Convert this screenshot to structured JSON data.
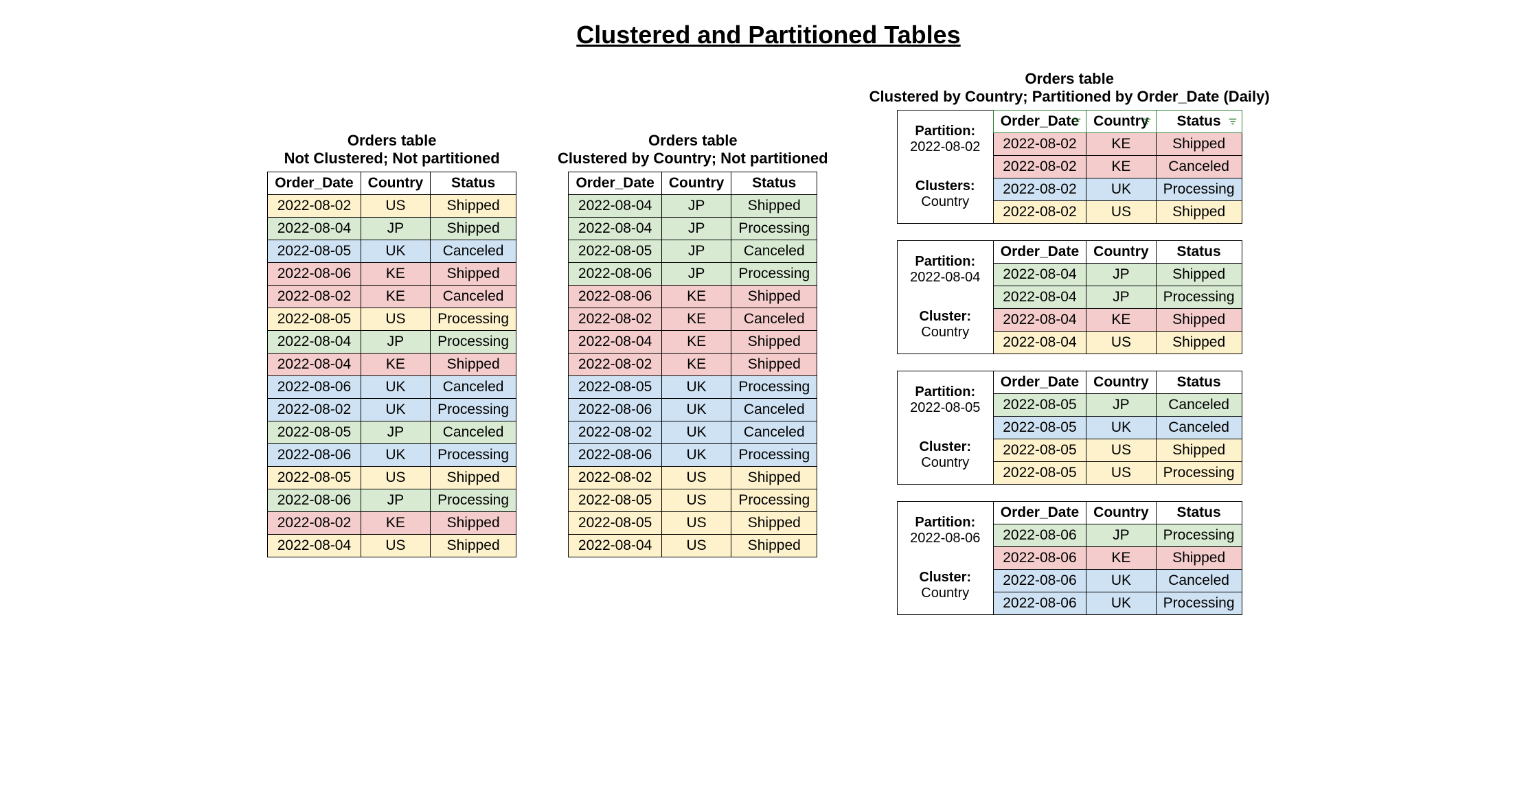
{
  "title": "Clustered and Partitioned Tables",
  "columns": [
    "Order_Date",
    "Country",
    "Status"
  ],
  "colors": {
    "US": "c-us",
    "JP": "c-jp",
    "UK": "c-uk",
    "KE": "c-ke"
  },
  "left": {
    "title": "Orders table",
    "subtitle": "Not Clustered; Not partitioned",
    "rows": [
      [
        "2022-08-02",
        "US",
        "Shipped"
      ],
      [
        "2022-08-04",
        "JP",
        "Shipped"
      ],
      [
        "2022-08-05",
        "UK",
        "Canceled"
      ],
      [
        "2022-08-06",
        "KE",
        "Shipped"
      ],
      [
        "2022-08-02",
        "KE",
        "Canceled"
      ],
      [
        "2022-08-05",
        "US",
        "Processing"
      ],
      [
        "2022-08-04",
        "JP",
        "Processing"
      ],
      [
        "2022-08-04",
        "KE",
        "Shipped"
      ],
      [
        "2022-08-06",
        "UK",
        "Canceled"
      ],
      [
        "2022-08-02",
        "UK",
        "Processing"
      ],
      [
        "2022-08-05",
        "JP",
        "Canceled"
      ],
      [
        "2022-08-06",
        "UK",
        "Processing"
      ],
      [
        "2022-08-05",
        "US",
        "Shipped"
      ],
      [
        "2022-08-06",
        "JP",
        "Processing"
      ],
      [
        "2022-08-02",
        "KE",
        "Shipped"
      ],
      [
        "2022-08-04",
        "US",
        "Shipped"
      ]
    ]
  },
  "mid": {
    "title": "Orders table",
    "subtitle": "Clustered by Country; Not partitioned",
    "rows": [
      [
        "2022-08-04",
        "JP",
        "Shipped"
      ],
      [
        "2022-08-04",
        "JP",
        "Processing"
      ],
      [
        "2022-08-05",
        "JP",
        "Canceled"
      ],
      [
        "2022-08-06",
        "JP",
        "Processing"
      ],
      [
        "2022-08-06",
        "KE",
        "Shipped"
      ],
      [
        "2022-08-02",
        "KE",
        "Canceled"
      ],
      [
        "2022-08-04",
        "KE",
        "Shipped"
      ],
      [
        "2022-08-02",
        "KE",
        "Shipped"
      ],
      [
        "2022-08-05",
        "UK",
        "Processing"
      ],
      [
        "2022-08-06",
        "UK",
        "Canceled"
      ],
      [
        "2022-08-02",
        "UK",
        "Canceled"
      ],
      [
        "2022-08-06",
        "UK",
        "Processing"
      ],
      [
        "2022-08-02",
        "US",
        "Shipped"
      ],
      [
        "2022-08-05",
        "US",
        "Processing"
      ],
      [
        "2022-08-05",
        "US",
        "Shipped"
      ],
      [
        "2022-08-04",
        "US",
        "Shipped"
      ]
    ]
  },
  "right": {
    "title": "Orders table",
    "subtitle": "Clustered by Country; Partitioned by Order_Date (Daily)",
    "showFilterIcons": true,
    "partitions": [
      {
        "partitionLabel": "Partition:",
        "partitionValue": "2022-08-02",
        "clusterLabel": "Clusters:",
        "clusterValue": "Country",
        "highlightHeader": true,
        "rows": [
          [
            "2022-08-02",
            "KE",
            "Shipped"
          ],
          [
            "2022-08-02",
            "KE",
            "Canceled"
          ],
          [
            "2022-08-02",
            "UK",
            "Processing"
          ],
          [
            "2022-08-02",
            "US",
            "Shipped"
          ]
        ]
      },
      {
        "partitionLabel": "Partition:",
        "partitionValue": "2022-08-04",
        "clusterLabel": "Cluster:",
        "clusterValue": "Country",
        "rows": [
          [
            "2022-08-04",
            "JP",
            "Shipped"
          ],
          [
            "2022-08-04",
            "JP",
            "Processing"
          ],
          [
            "2022-08-04",
            "KE",
            "Shipped"
          ],
          [
            "2022-08-04",
            "US",
            "Shipped"
          ]
        ]
      },
      {
        "partitionLabel": "Partition:",
        "partitionValue": "2022-08-05",
        "clusterLabel": "Cluster:",
        "clusterValue": "Country",
        "rows": [
          [
            "2022-08-05",
            "JP",
            "Canceled"
          ],
          [
            "2022-08-05",
            "UK",
            "Canceled"
          ],
          [
            "2022-08-05",
            "US",
            "Shipped"
          ],
          [
            "2022-08-05",
            "US",
            "Processing"
          ]
        ]
      },
      {
        "partitionLabel": "Partition:",
        "partitionValue": "2022-08-06",
        "clusterLabel": "Cluster:",
        "clusterValue": "Country",
        "rows": [
          [
            "2022-08-06",
            "JP",
            "Processing"
          ],
          [
            "2022-08-06",
            "KE",
            "Shipped"
          ],
          [
            "2022-08-06",
            "UK",
            "Canceled"
          ],
          [
            "2022-08-06",
            "UK",
            "Processing"
          ]
        ]
      }
    ]
  }
}
